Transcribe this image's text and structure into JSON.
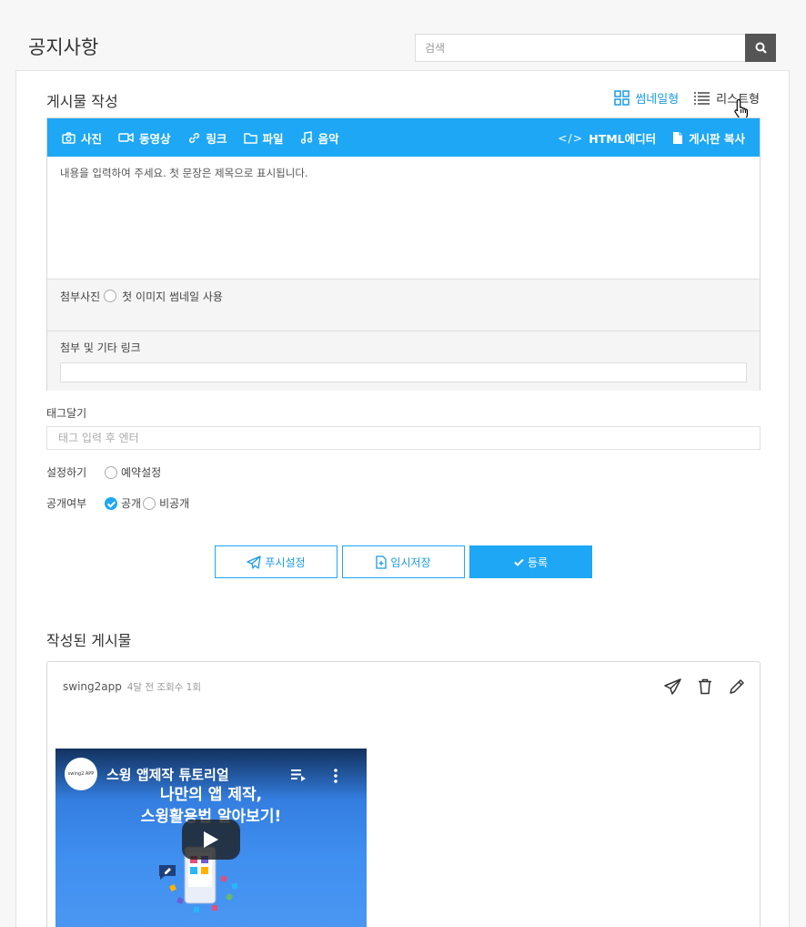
{
  "page": {
    "title": "공지사항"
  },
  "search": {
    "placeholder": "검색"
  },
  "compose": {
    "title": "게시물 작성",
    "view_toggle": [
      {
        "label": "썸네일형",
        "icon": "thumbnail-grid-icon",
        "active": true
      },
      {
        "label": "리스트형",
        "icon": "list-icon",
        "active": false
      }
    ],
    "toolbar": {
      "photo": "사진",
      "video": "동영상",
      "link": "링크",
      "file": "파일",
      "music": "음악",
      "html_editor": "HTML에디터",
      "copy_board": "게시판 복사"
    },
    "body_placeholder": "내용을 입력하여 주세요. 첫 문장은 제목으로 표시됩니다.",
    "attach_photo_label": "첨부사진",
    "use_first_image_thumbnail": "첫 이미지 썸네일 사용",
    "attach_links_label": "첨부 및 기타 링크"
  },
  "tags": {
    "label": "태그달기",
    "placeholder": "태그 입력 후 엔터"
  },
  "settings": {
    "label": "설정하기",
    "reserve": "예약설정"
  },
  "visibility": {
    "label": "공개여부",
    "public": "공개",
    "private": "비공개",
    "selected": "공개"
  },
  "buttons": {
    "push": "푸시설정",
    "temp_save": "임시저장",
    "submit": "등록"
  },
  "posted": {
    "title": "작성된 게시물",
    "author": "swing2app",
    "meta": "4달 전 조회수 1회",
    "video": {
      "channel_logo_text": "swing2 APP",
      "title": "스윙 앱제작 튜토리얼",
      "headline_1": "나만의 앱 제작,",
      "headline_2": "스윙활용법 알아보기!"
    }
  },
  "colors": {
    "accent": "#1ea7f5",
    "search_button": "#555555",
    "video_bg": "#3f8ff0"
  }
}
